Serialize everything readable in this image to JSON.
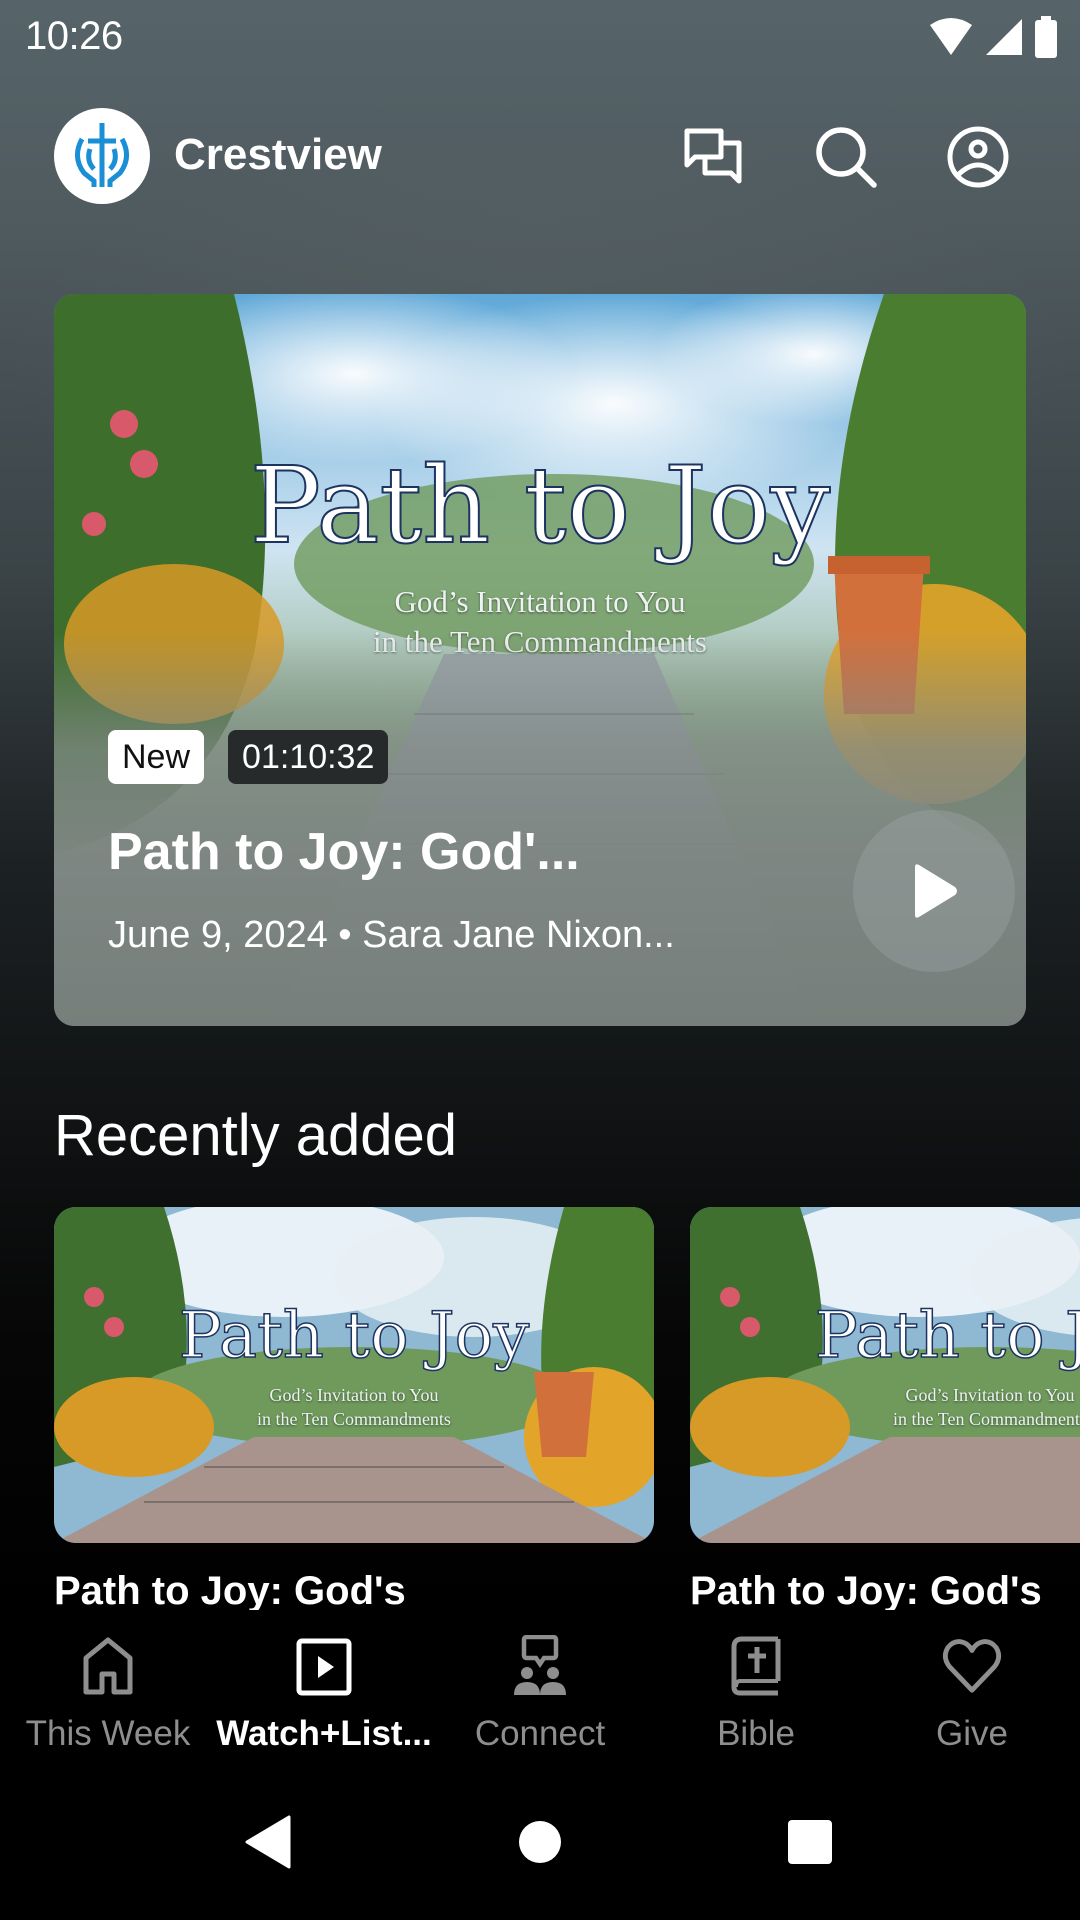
{
  "status_bar": {
    "time": "10:26",
    "icons": [
      "wifi-icon",
      "signal-icon",
      "battery-icon"
    ]
  },
  "app_bar": {
    "title": "Crestview",
    "logo": "church-cross-logo",
    "actions": [
      {
        "name": "messages",
        "icon": "chat-bubbles-icon"
      },
      {
        "name": "search",
        "icon": "search-icon"
      },
      {
        "name": "profile",
        "icon": "account-circle-icon"
      }
    ]
  },
  "hero": {
    "artwork": {
      "title": "Path to Joy",
      "subtitle_line1": "God’s Invitation to You",
      "subtitle_line2": "in the Ten Commandments"
    },
    "badge_new": "New",
    "duration": "01:10:32",
    "title": "Path to Joy: God'...",
    "meta": "June 9, 2024 • Sara Jane Nixon...",
    "play_icon": "play-icon"
  },
  "recently_added": {
    "heading": "Recently added",
    "items": [
      {
        "title": "Path to Joy: God's",
        "art_title": "Path to Joy",
        "art_sub1": "God’s Invitation to You",
        "art_sub2": "in the Ten Commandments"
      },
      {
        "title": "Path to Joy: God's",
        "art_title": "Path to Joy",
        "art_sub1": "God’s Invitation to You",
        "art_sub2": "in the Ten Commandments"
      }
    ]
  },
  "bottom_nav": {
    "items": [
      {
        "label": "This Week",
        "icon": "home-icon",
        "active": false
      },
      {
        "label": "Watch+List...",
        "icon": "play-box-icon",
        "active": true
      },
      {
        "label": "Connect",
        "icon": "group-chat-icon",
        "active": false
      },
      {
        "label": "Bible",
        "icon": "bible-icon",
        "active": false
      },
      {
        "label": "Give",
        "icon": "heart-icon",
        "active": false
      }
    ]
  },
  "colors": {
    "accent_logo": "#1a8fd6",
    "nav_inactive": "#8e8e8e",
    "nav_active": "#ffffff"
  }
}
